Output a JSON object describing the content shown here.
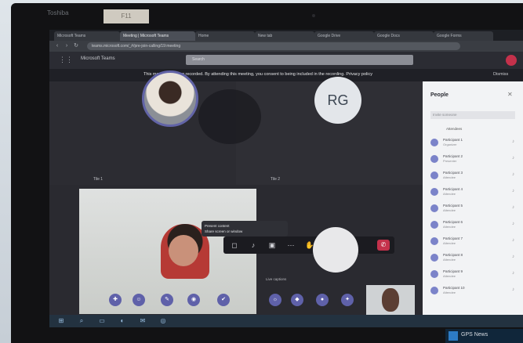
{
  "bezel": {
    "brand_label": "Toshiba",
    "tag_label": "F11"
  },
  "browser": {
    "tabs": [
      {
        "label": "Microsoft Teams"
      },
      {
        "label": "Meeting | Microsoft Teams"
      },
      {
        "label": "Home"
      },
      {
        "label": "New tab"
      },
      {
        "label": "Google Drive"
      },
      {
        "label": "Google Docs"
      },
      {
        "label": "Google Forms"
      }
    ],
    "url": "teams.microsoft.com/_#/pre-join-calling/19:meeting"
  },
  "teams": {
    "app_title": "Microsoft Teams",
    "search_placeholder": "Search",
    "recording_banner": "This meeting is being recorded. By attending this meeting, you consent to being included in the recording. Privacy policy",
    "dismiss_label": "Dismiss",
    "rg_initials": "RG",
    "tile_name_left": "Tile 1",
    "tile_name_right": "Tile 2",
    "tooltip_lines": [
      "Present content",
      "Share screen or window"
    ],
    "caption_note": "Live captions",
    "controls": [
      {
        "icon": "camera-icon",
        "glyph": "◻"
      },
      {
        "icon": "mic-icon",
        "glyph": "♪"
      },
      {
        "icon": "share-icon",
        "glyph": "▣"
      },
      {
        "icon": "more-icon",
        "glyph": "⋯"
      },
      {
        "icon": "raise-hand-icon",
        "glyph": "✋"
      },
      {
        "icon": "chat-icon",
        "glyph": "✉"
      },
      {
        "icon": "people-icon",
        "glyph": "☺"
      }
    ],
    "hangup_glyph": "✆",
    "reactions": [
      "✚",
      "☺",
      "✎",
      "◉",
      "✔",
      "☼",
      "◆",
      "●",
      "✦"
    ]
  },
  "people_panel": {
    "title": "People",
    "search_placeholder": "Invite someone",
    "section_label": "Attendees",
    "participants": [
      {
        "name": "Participant 1",
        "sub": "Organizer"
      },
      {
        "name": "Participant 2",
        "sub": "Presenter"
      },
      {
        "name": "Participant 3",
        "sub": "Attendee"
      },
      {
        "name": "Participant 4",
        "sub": "Attendee"
      },
      {
        "name": "Participant 5",
        "sub": "Attendee"
      },
      {
        "name": "Participant 6",
        "sub": "Attendee"
      },
      {
        "name": "Participant 7",
        "sub": "Attendee"
      },
      {
        "name": "Participant 8",
        "sub": "Attendee"
      },
      {
        "name": "Participant 9",
        "sub": "Attendee"
      },
      {
        "name": "Participant 10",
        "sub": "Attendee"
      }
    ]
  },
  "taskbar": {
    "icons": [
      "⊞",
      "⌕",
      "▭",
      "◐",
      "✉",
      "◎"
    ]
  },
  "watermark": {
    "text": "GPS News"
  },
  "colors": {
    "teams_accent": "#6264a7",
    "hangup": "#c4314b",
    "banner_bg": "#1f2026"
  }
}
